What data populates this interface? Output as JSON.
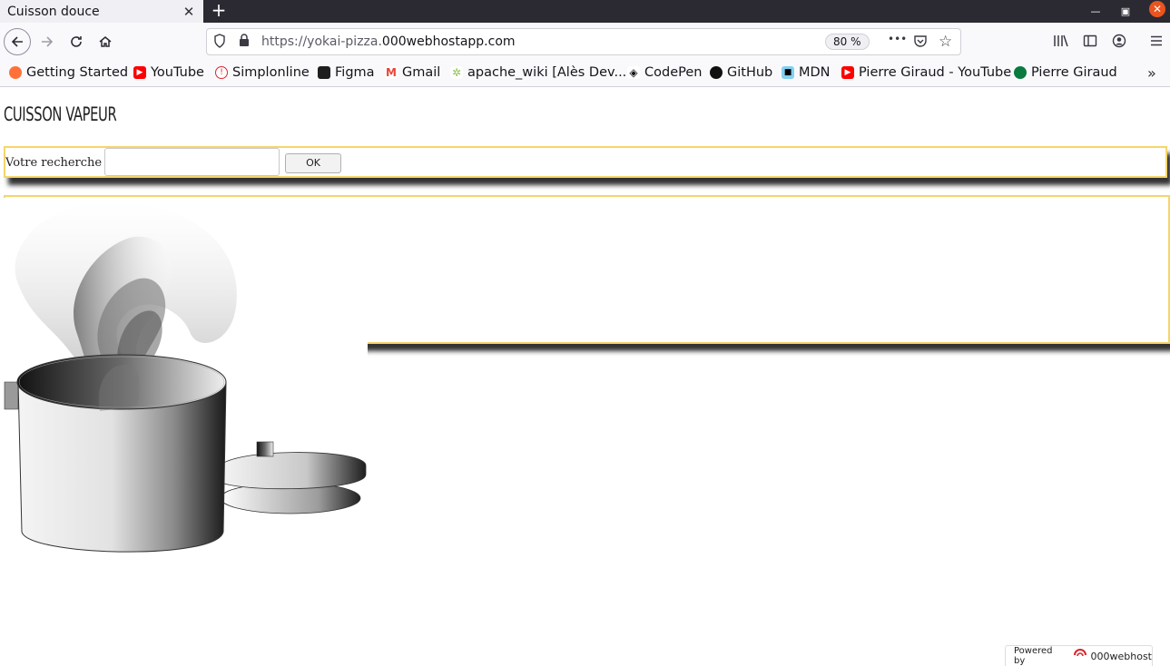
{
  "browser": {
    "tab_title": "Cuisson douce",
    "tab_close": "✕",
    "new_tab": "+",
    "url_prefix": "https://yokai-pizza.",
    "url_host": "000webhostapp.com",
    "zoom": "80 %",
    "more_glyph": "•••"
  },
  "bookmarks": [
    {
      "label": "Getting Started",
      "icon": "firefox-icon",
      "color": "#ff7139"
    },
    {
      "label": "YouTube",
      "icon": "youtube-icon",
      "color": "#ff0000"
    },
    {
      "label": "Simplonline",
      "icon": "simplonline-icon",
      "color": "#e0242b"
    },
    {
      "label": "Figma",
      "icon": "figma-icon",
      "color": "#1e1e1e"
    },
    {
      "label": "Gmail",
      "icon": "gmail-icon",
      "color": "#ea4335"
    },
    {
      "label": "apache_wiki [Alès Dev...",
      "icon": "apache-wiki-icon",
      "color": "#8bc34a"
    },
    {
      "label": "CodePen",
      "icon": "codepen-icon",
      "color": "#111111"
    },
    {
      "label": "GitHub",
      "icon": "github-icon",
      "color": "#111111"
    },
    {
      "label": "MDN",
      "icon": "mdn-icon",
      "color": "#83d0f2"
    },
    {
      "label": "Pierre Giraud - YouTube",
      "icon": "youtube-icon",
      "color": "#ff0000"
    },
    {
      "label": "Pierre Giraud",
      "icon": "pierre-giraud-icon",
      "color": "#0a7a3e"
    }
  ],
  "page": {
    "title": "CUISSON VAPEUR",
    "search_label": "Votre recherche",
    "search_value": "",
    "ok_label": "OK"
  },
  "footer": {
    "powered_by": "Powered by",
    "brand": "000webhost"
  },
  "colors": {
    "box_border": "#f6d56c",
    "accent_close": "#e95420"
  }
}
